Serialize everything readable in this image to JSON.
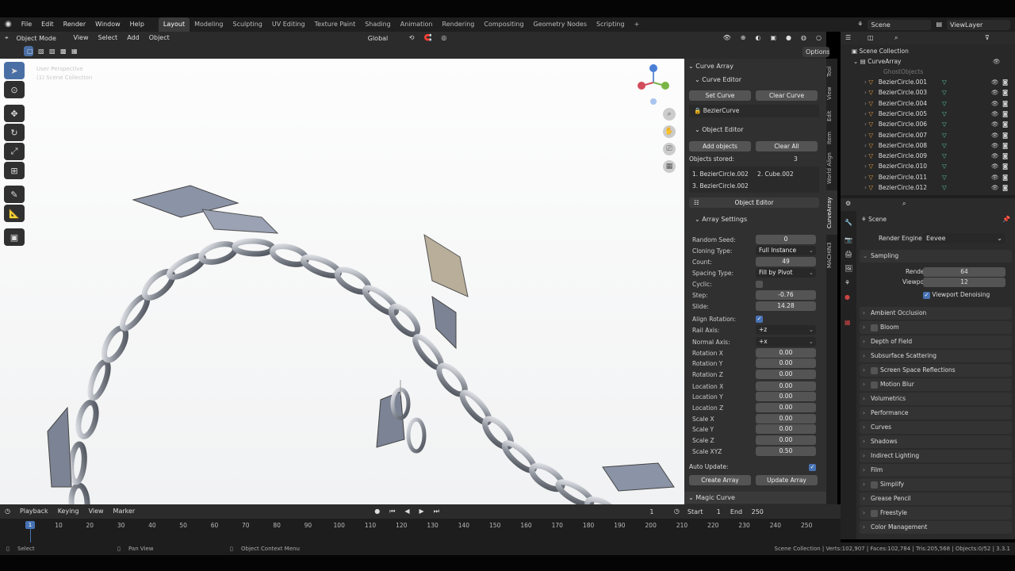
{
  "menus": [
    "File",
    "Edit",
    "Render",
    "Window",
    "Help"
  ],
  "workspaces": [
    "Layout",
    "Modeling",
    "Sculpting",
    "UV Editing",
    "Texture Paint",
    "Shading",
    "Animation",
    "Rendering",
    "Compositing",
    "Geometry Nodes",
    "Scripting"
  ],
  "active_workspace": "Layout",
  "scene_name": "Scene",
  "view_layer": "ViewLayer",
  "viewport_header": {
    "mode": "Object Mode",
    "view": "View",
    "select": "Select",
    "add": "Add",
    "object": "Object",
    "orientation": "Global",
    "options": "Options"
  },
  "npanel": {
    "curve_array": "Curve Array",
    "curve_editor": "Curve Editor",
    "set_curve": "Set Curve",
    "clear_curve": "Clear Curve",
    "curve_name": "BezierCurve",
    "object_editor": "Object Editor",
    "add_objects": "Add objects",
    "clear_all": "Clear All",
    "objects_stored_label": "Objects stored:",
    "objects_stored": "3",
    "stored_1": "1. BezierCircle.002",
    "stored_2": "2. Cube.002",
    "stored_3": "3. BezierCircle.002",
    "object_editor_btn": "Object Editor",
    "array_settings": "Array Settings",
    "settings": [
      {
        "label": "Random Seed:",
        "value": "0",
        "kind": "num"
      },
      {
        "label": "Cloning Type:",
        "value": "Full Instance",
        "kind": "drop"
      },
      {
        "label": "Count:",
        "value": "49",
        "kind": "num"
      },
      {
        "label": "Spacing Type:",
        "value": "Fill by Pivot",
        "kind": "drop"
      },
      {
        "label": "Cyclic:",
        "value": "",
        "kind": "chk"
      },
      {
        "label": "Step:",
        "value": "-0.76",
        "kind": "num"
      },
      {
        "label": "Slide:",
        "value": "14.28",
        "kind": "num"
      },
      {
        "label": "Align Rotation:",
        "value": "✓",
        "kind": "chkon"
      },
      {
        "label": "Rail Axis:",
        "value": "+z",
        "kind": "drop"
      },
      {
        "label": "Normal Axis:",
        "value": "+x",
        "kind": "drop"
      },
      {
        "label": "Rotation X",
        "value": "0.00",
        "kind": "num"
      },
      {
        "label": "Rotation Y",
        "value": "0.00",
        "kind": "num"
      },
      {
        "label": "Rotation Z",
        "value": "0.00",
        "kind": "num"
      },
      {
        "label": "Location X",
        "value": "0.00",
        "kind": "num"
      },
      {
        "label": "Location Y",
        "value": "0.00",
        "kind": "num"
      },
      {
        "label": "Location Z",
        "value": "0.00",
        "kind": "num"
      },
      {
        "label": "Scale X",
        "value": "0.00",
        "kind": "num"
      },
      {
        "label": "Scale Y",
        "value": "0.00",
        "kind": "num"
      },
      {
        "label": "Scale Z",
        "value": "0.00",
        "kind": "num"
      },
      {
        "label": "Scale XYZ",
        "value": "0.50",
        "kind": "num"
      }
    ],
    "auto_update": "Auto Update:",
    "create_array": "Create Array",
    "update_array": "Update Array",
    "magic_curve": "Magic Curve"
  },
  "ntabs": [
    "Tool",
    "View",
    "Edit",
    "Item",
    "World Align",
    "CurveArray",
    "MACHIN3"
  ],
  "outliner": {
    "root": "Scene Collection",
    "collection": "CurveArray",
    "ghost": "GhostObjects",
    "items": [
      "BezierCircle.001",
      "BezierCircle.003",
      "BezierCircle.004",
      "BezierCircle.005",
      "BezierCircle.006",
      "BezierCircle.007",
      "BezierCircle.008",
      "BezierCircle.009",
      "BezierCircle.010",
      "BezierCircle.011",
      "BezierCircle.012"
    ]
  },
  "properties": {
    "scene": "Scene",
    "render_engine_label": "Render Engine",
    "render_engine": "Eevee",
    "sampling": "Sampling",
    "render_label": "Render",
    "render_val": "64",
    "viewport_label": "Viewport",
    "viewport_val": "12",
    "viewport_denoising": "Viewport Denoising",
    "sections": [
      "Ambient Occlusion",
      "Bloom",
      "Depth of Field",
      "Subsurface Scattering",
      "Screen Space Reflections",
      "Motion Blur",
      "Volumetrics",
      "Performance",
      "Curves",
      "Shadows",
      "Indirect Lighting",
      "Film",
      "Simplify",
      "Grease Pencil",
      "Freestyle",
      "Color Management"
    ]
  },
  "timeline": {
    "playback": "Playback",
    "keying": "Keying",
    "view": "View",
    "marker": "Marker",
    "current": "1",
    "start_label": "Start",
    "start": "1",
    "end_label": "End",
    "end": "250",
    "ticks": [
      "10",
      "20",
      "30",
      "40",
      "50",
      "60",
      "70",
      "80",
      "90",
      "100",
      "110",
      "120",
      "130",
      "140",
      "150",
      "160",
      "170",
      "180",
      "190",
      "200",
      "210",
      "220",
      "230",
      "240",
      "250"
    ]
  },
  "status": {
    "select": "Select",
    "pan": "Pan View",
    "context": "Object Context Menu",
    "stats": "Scene Collection | Verts:102,907 | Faces:102,784 | Tris:205,568 | Objects:0/52 | 3.3.1"
  }
}
